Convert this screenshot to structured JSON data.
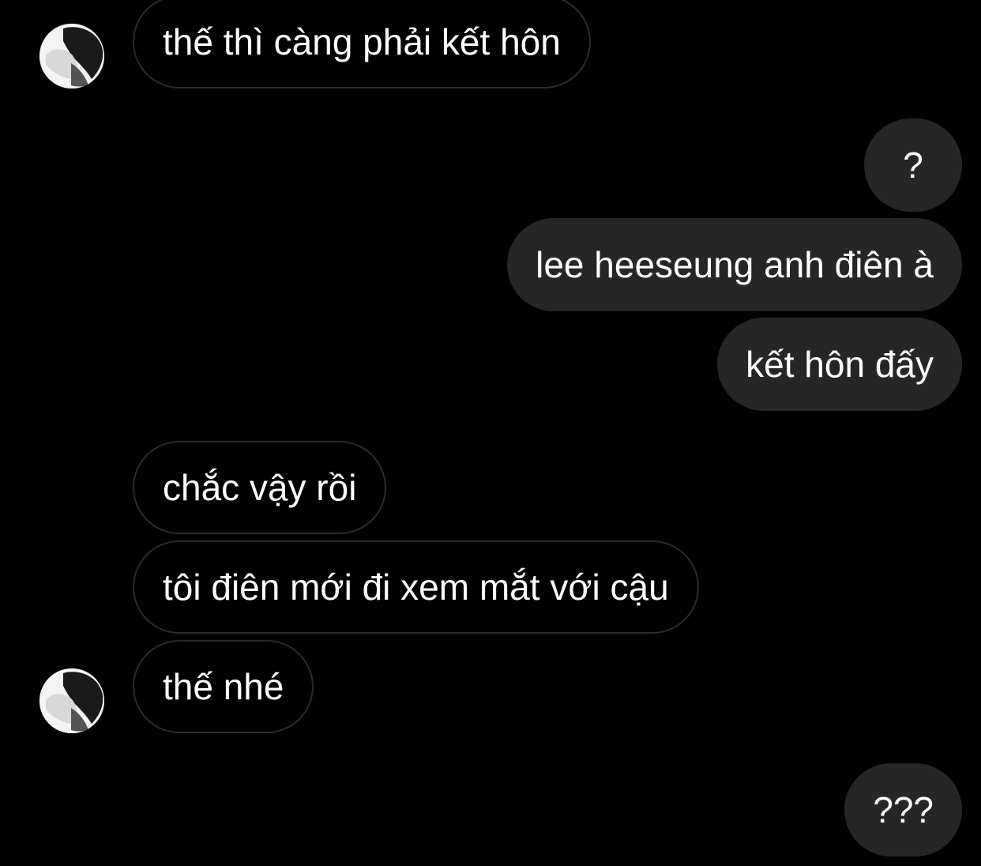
{
  "thread": {
    "messages": [
      {
        "side": "incoming",
        "text": "thế thì càng phải kết hôn",
        "avatar": true
      },
      {
        "side": "outgoing",
        "text": "?"
      },
      {
        "side": "outgoing",
        "text": "lee heeseung anh điên à"
      },
      {
        "side": "outgoing",
        "text": "kết hôn đấy"
      },
      {
        "side": "incoming",
        "text": "chắc vậy rồi"
      },
      {
        "side": "incoming",
        "text": "tôi điên mới đi xem mắt với cậu"
      },
      {
        "side": "incoming",
        "text": "thế nhé",
        "avatar": true
      },
      {
        "side": "outgoing",
        "text": "???"
      }
    ]
  },
  "colors": {
    "background": "#000000",
    "outgoing_bubble": "#262626",
    "incoming_border": "#2a2a2a",
    "text": "#ffffff"
  },
  "icons": {
    "avatar": "profile-photo"
  }
}
